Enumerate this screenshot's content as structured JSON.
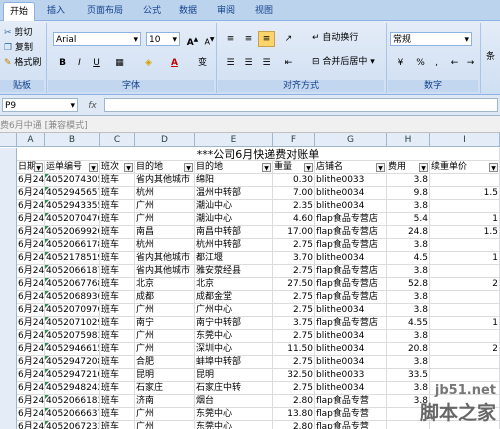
{
  "ribbon": {
    "tabs": [
      "开始",
      "插入",
      "页面布局",
      "公式",
      "数据",
      "审阅",
      "视图"
    ],
    "clipboard": {
      "cut": "剪切",
      "copy": "复制",
      "format_painter": "格式刷",
      "group": "贴板"
    },
    "font": {
      "name": "Arial",
      "size": "10",
      "bold": "B",
      "italic": "I",
      "underline": "U",
      "group": "字体",
      "wen": "变"
    },
    "alignment": {
      "wrap": "自动换行",
      "merge": "合并后居中",
      "group": "对齐方式"
    },
    "number": {
      "format": "常规",
      "percent": "%",
      "comma": ",",
      "group": "数字",
      "more": "条"
    }
  },
  "formula_bar": {
    "name_box": "P9",
    "fx": "fx",
    "value": ""
  },
  "window_title": "费6月中通 [兼容模式]",
  "columns": [
    "A",
    "B",
    "C",
    "D",
    "E",
    "F",
    "G",
    "H",
    "I"
  ],
  "sheet_title": "***公司6月快递费对账单",
  "headers": [
    "日期",
    "运单编号",
    "班次",
    "目的地",
    "目的地",
    "重量",
    "店铺名",
    "费用",
    "续重单价"
  ],
  "rows": [
    [
      "6月24日",
      "4052074305",
      "班车",
      "省内其他城市",
      "绵阳",
      "0.30",
      "blithe0033",
      "3.8",
      ""
    ],
    [
      "6月24日",
      "4052945657",
      "班车",
      "杭州",
      "温州中转部",
      "7.00",
      "blithe0034",
      "9.8",
      "1.5"
    ],
    [
      "6月24日",
      "4052943355",
      "班车",
      "广州",
      "潮汕中心",
      "2.35",
      "blithe0034",
      "3.8",
      ""
    ],
    [
      "6月24日",
      "4052070470",
      "班车",
      "广州",
      "潮汕中心",
      "4.60",
      "flap食品专营店",
      "5.4",
      "1"
    ],
    [
      "6月24日",
      "4052069920",
      "班车",
      "南昌",
      "南昌中转部",
      "17.00",
      "flap食品专营店",
      "24.8",
      "1.5"
    ],
    [
      "6月24日",
      "4052066178",
      "班车",
      "杭州",
      "杭州中转部",
      "2.75",
      "flap食品专营店",
      "3.8",
      ""
    ],
    [
      "6月24日",
      "4052178519",
      "班车",
      "省内其他城市",
      "都江堰",
      "3.70",
      "blithe0034",
      "4.5",
      "1"
    ],
    [
      "6月24日",
      "4052066187",
      "班车",
      "省内其他城市",
      "雅安荥经县",
      "2.75",
      "flap食品专营店",
      "3.8",
      ""
    ],
    [
      "6月24日",
      "4052067768",
      "班车",
      "北京",
      "北京",
      "27.50",
      "flap食品专营店",
      "52.8",
      "2"
    ],
    [
      "6月24日",
      "4052068936",
      "班车",
      "成都",
      "成都金堂",
      "2.75",
      "flap食品专营店",
      "3.8",
      ""
    ],
    [
      "6月24日",
      "4052070976",
      "班车",
      "广州",
      "广州中心",
      "2.75",
      "blithe0034",
      "3.8",
      ""
    ],
    [
      "6月24日",
      "4052071029",
      "班车",
      "南宁",
      "南宁中转部",
      "3.75",
      "flap食品专营店",
      "4.55",
      "1"
    ],
    [
      "6月24日",
      "4052075983",
      "班车",
      "广州",
      "东莞中心",
      "2.75",
      "blithe0034",
      "3.8",
      ""
    ],
    [
      "6月24日",
      "4052946615",
      "班车",
      "广州",
      "深圳中心",
      "11.50",
      "blithe0034",
      "20.8",
      "2"
    ],
    [
      "6月24日",
      "4052947208",
      "班车",
      "合肥",
      "蚌埠中转部",
      "2.75",
      "blithe0034",
      "3.8",
      ""
    ],
    [
      "6月24日",
      "4052947210",
      "班车",
      "昆明",
      "昆明",
      "32.50",
      "blithe0033",
      "33.5",
      ""
    ],
    [
      "6月24日",
      "4052948242",
      "班车",
      "石家庄",
      "石家庄中转",
      "2.75",
      "blithe0034",
      "3.8",
      ""
    ],
    [
      "6月24日",
      "4052066183",
      "班车",
      "济南",
      "烟台",
      "2.80",
      "flap食品专营",
      "3.8",
      ""
    ],
    [
      "6月24日",
      "4052066637",
      "班车",
      "广州",
      "东莞中心",
      "13.80",
      "flap食品专营",
      "",
      ""
    ],
    [
      "6月24日",
      "4052067233",
      "班车",
      "广州",
      "东莞中心",
      "2.80",
      "flap食品专营",
      "",
      ""
    ]
  ],
  "watermark": {
    "line1": "jb51.net",
    "line2": "脚本之家"
  },
  "colors": {
    "ribbon": "#dce7f5",
    "accent": "#15428b",
    "grid": "#dadcdd",
    "header": "#e4ecf7"
  }
}
